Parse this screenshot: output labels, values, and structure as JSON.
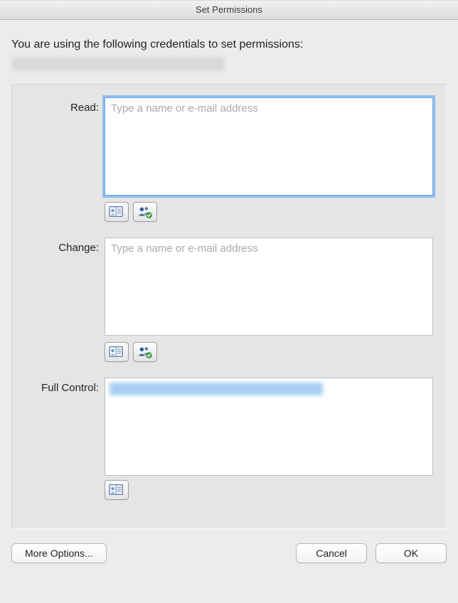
{
  "window": {
    "title": "Set Permissions"
  },
  "intro": "You are using the following credentials to set permissions:",
  "fields": {
    "read": {
      "label": "Read:",
      "placeholder": "Type a name or e-mail address",
      "value": ""
    },
    "change": {
      "label": "Change:",
      "placeholder": "Type a name or e-mail address",
      "value": ""
    },
    "fullcontrol": {
      "label": "Full Control:"
    }
  },
  "buttons": {
    "more_options": "More Options...",
    "cancel": "Cancel",
    "ok": "OK"
  }
}
